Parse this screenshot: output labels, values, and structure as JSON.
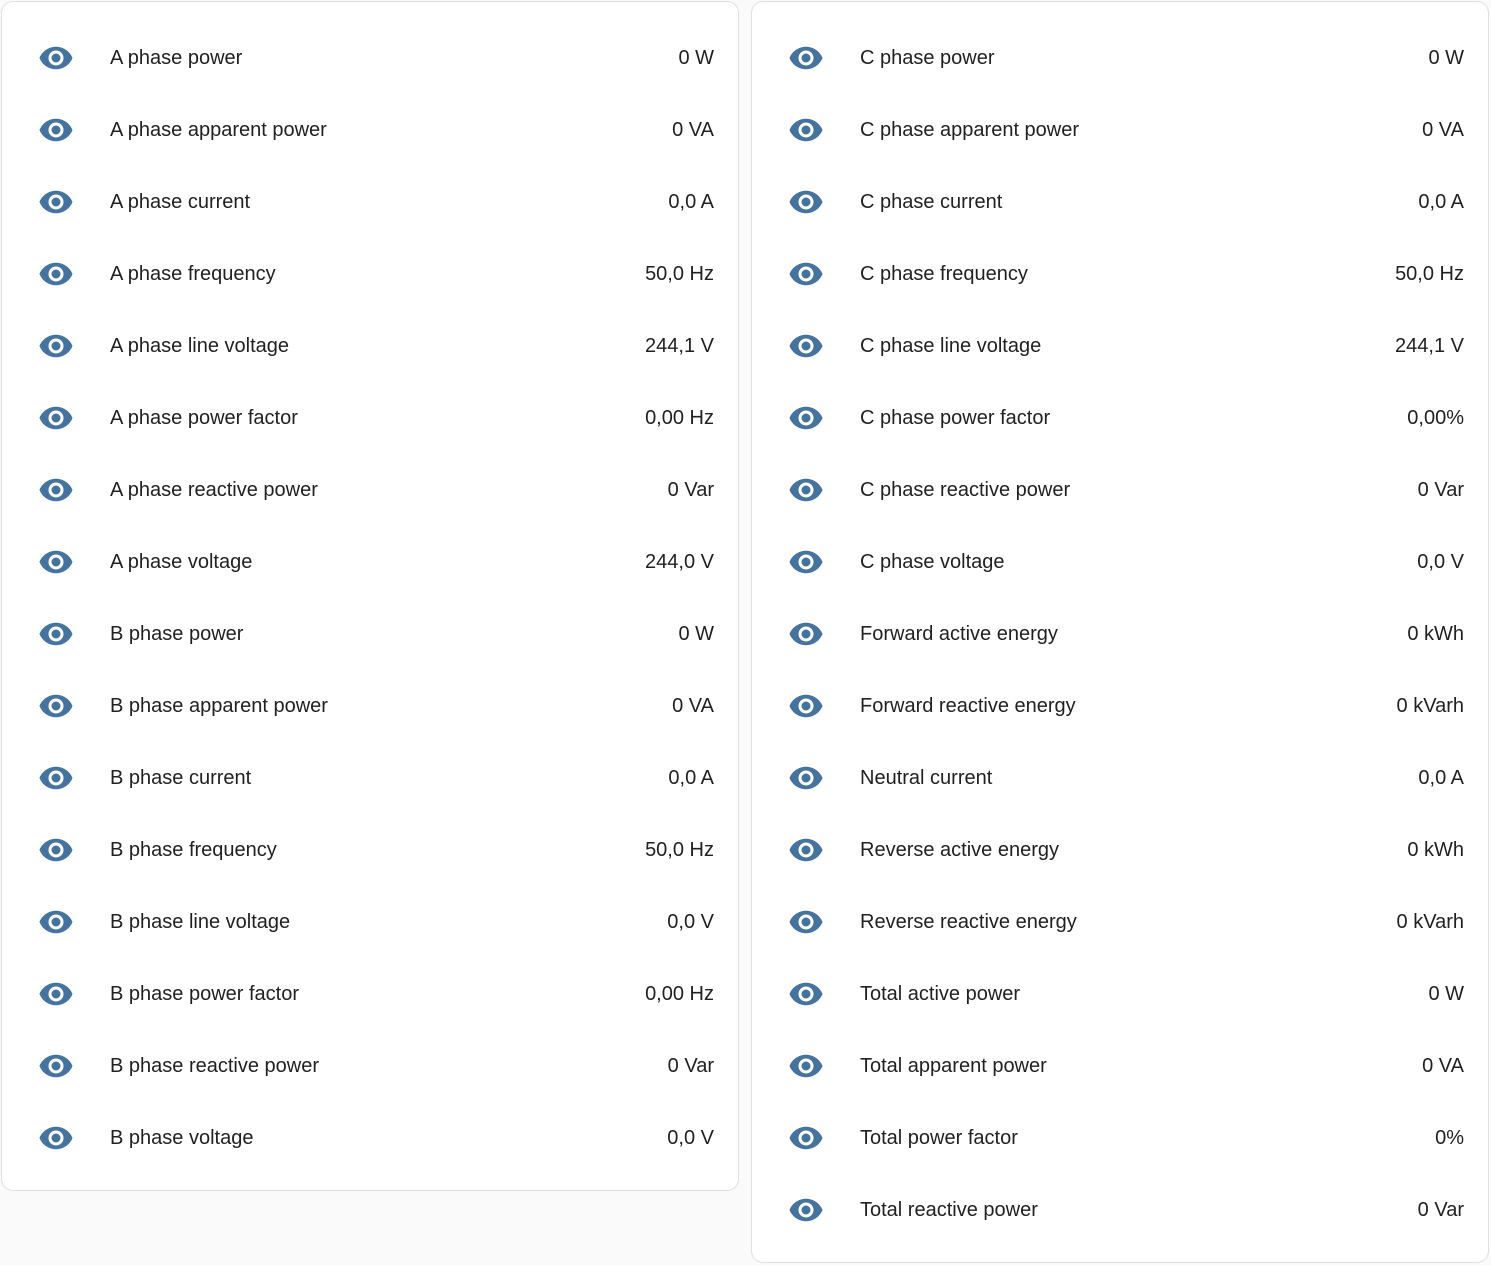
{
  "colors": {
    "icon": "#44739e",
    "background": "#fafafa",
    "card": "#ffffff"
  },
  "icon_name": "eye-icon",
  "left_card": {
    "rows": [
      {
        "name": "A phase power",
        "value": "0 W"
      },
      {
        "name": "A phase apparent power",
        "value": "0 VA"
      },
      {
        "name": "A phase current",
        "value": "0,0 A"
      },
      {
        "name": "A phase frequency",
        "value": "50,0 Hz"
      },
      {
        "name": "A phase line voltage",
        "value": "244,1 V"
      },
      {
        "name": "A phase power factor",
        "value": "0,00 Hz"
      },
      {
        "name": "A phase reactive power",
        "value": "0 Var"
      },
      {
        "name": "A phase voltage",
        "value": "244,0 V"
      },
      {
        "name": "B phase power",
        "value": "0 W"
      },
      {
        "name": "B phase apparent power",
        "value": "0 VA"
      },
      {
        "name": "B phase current",
        "value": "0,0 A"
      },
      {
        "name": "B phase frequency",
        "value": "50,0 Hz"
      },
      {
        "name": "B phase line voltage",
        "value": "0,0 V"
      },
      {
        "name": "B phase power factor",
        "value": "0,00 Hz"
      },
      {
        "name": "B phase reactive power",
        "value": "0 Var"
      },
      {
        "name": "B phase voltage",
        "value": "0,0 V"
      }
    ]
  },
  "right_card": {
    "rows": [
      {
        "name": "C phase power",
        "value": "0 W"
      },
      {
        "name": "C phase apparent power",
        "value": "0 VA"
      },
      {
        "name": "C phase current",
        "value": "0,0 A"
      },
      {
        "name": "C phase frequency",
        "value": "50,0 Hz"
      },
      {
        "name": "C phase line voltage",
        "value": "244,1 V"
      },
      {
        "name": "C phase power factor",
        "value": "0,00%"
      },
      {
        "name": "C phase reactive power",
        "value": "0 Var"
      },
      {
        "name": "C phase voltage",
        "value": "0,0 V"
      },
      {
        "name": "Forward active energy",
        "value": "0 kWh"
      },
      {
        "name": "Forward reactive energy",
        "value": "0 kVarh"
      },
      {
        "name": "Neutral current",
        "value": "0,0 A"
      },
      {
        "name": "Reverse active energy",
        "value": "0 kWh"
      },
      {
        "name": "Reverse reactive energy",
        "value": "0 kVarh"
      },
      {
        "name": "Total active power",
        "value": "0 W"
      },
      {
        "name": "Total apparent power",
        "value": "0 VA"
      },
      {
        "name": "Total power factor",
        "value": "0%"
      },
      {
        "name": "Total reactive power",
        "value": "0 Var"
      }
    ]
  }
}
